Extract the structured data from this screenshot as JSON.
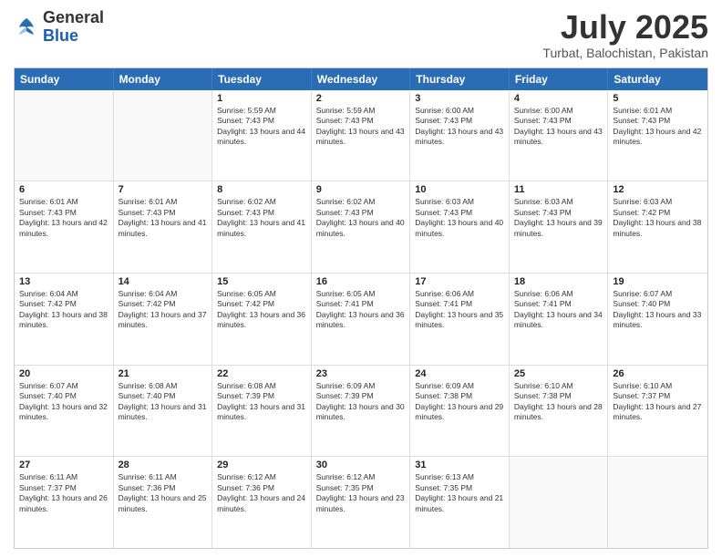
{
  "logo": {
    "general": "General",
    "blue": "Blue"
  },
  "title": "July 2025",
  "subtitle": "Turbat, Balochistan, Pakistan",
  "days_of_week": [
    "Sunday",
    "Monday",
    "Tuesday",
    "Wednesday",
    "Thursday",
    "Friday",
    "Saturday"
  ],
  "weeks": [
    [
      {
        "day": "",
        "sunrise": "",
        "sunset": "",
        "daylight": ""
      },
      {
        "day": "",
        "sunrise": "",
        "sunset": "",
        "daylight": ""
      },
      {
        "day": "1",
        "sunrise": "Sunrise: 5:59 AM",
        "sunset": "Sunset: 7:43 PM",
        "daylight": "Daylight: 13 hours and 44 minutes."
      },
      {
        "day": "2",
        "sunrise": "Sunrise: 5:59 AM",
        "sunset": "Sunset: 7:43 PM",
        "daylight": "Daylight: 13 hours and 43 minutes."
      },
      {
        "day": "3",
        "sunrise": "Sunrise: 6:00 AM",
        "sunset": "Sunset: 7:43 PM",
        "daylight": "Daylight: 13 hours and 43 minutes."
      },
      {
        "day": "4",
        "sunrise": "Sunrise: 6:00 AM",
        "sunset": "Sunset: 7:43 PM",
        "daylight": "Daylight: 13 hours and 43 minutes."
      },
      {
        "day": "5",
        "sunrise": "Sunrise: 6:01 AM",
        "sunset": "Sunset: 7:43 PM",
        "daylight": "Daylight: 13 hours and 42 minutes."
      }
    ],
    [
      {
        "day": "6",
        "sunrise": "Sunrise: 6:01 AM",
        "sunset": "Sunset: 7:43 PM",
        "daylight": "Daylight: 13 hours and 42 minutes."
      },
      {
        "day": "7",
        "sunrise": "Sunrise: 6:01 AM",
        "sunset": "Sunset: 7:43 PM",
        "daylight": "Daylight: 13 hours and 41 minutes."
      },
      {
        "day": "8",
        "sunrise": "Sunrise: 6:02 AM",
        "sunset": "Sunset: 7:43 PM",
        "daylight": "Daylight: 13 hours and 41 minutes."
      },
      {
        "day": "9",
        "sunrise": "Sunrise: 6:02 AM",
        "sunset": "Sunset: 7:43 PM",
        "daylight": "Daylight: 13 hours and 40 minutes."
      },
      {
        "day": "10",
        "sunrise": "Sunrise: 6:03 AM",
        "sunset": "Sunset: 7:43 PM",
        "daylight": "Daylight: 13 hours and 40 minutes."
      },
      {
        "day": "11",
        "sunrise": "Sunrise: 6:03 AM",
        "sunset": "Sunset: 7:43 PM",
        "daylight": "Daylight: 13 hours and 39 minutes."
      },
      {
        "day": "12",
        "sunrise": "Sunrise: 6:03 AM",
        "sunset": "Sunset: 7:42 PM",
        "daylight": "Daylight: 13 hours and 38 minutes."
      }
    ],
    [
      {
        "day": "13",
        "sunrise": "Sunrise: 6:04 AM",
        "sunset": "Sunset: 7:42 PM",
        "daylight": "Daylight: 13 hours and 38 minutes."
      },
      {
        "day": "14",
        "sunrise": "Sunrise: 6:04 AM",
        "sunset": "Sunset: 7:42 PM",
        "daylight": "Daylight: 13 hours and 37 minutes."
      },
      {
        "day": "15",
        "sunrise": "Sunrise: 6:05 AM",
        "sunset": "Sunset: 7:42 PM",
        "daylight": "Daylight: 13 hours and 36 minutes."
      },
      {
        "day": "16",
        "sunrise": "Sunrise: 6:05 AM",
        "sunset": "Sunset: 7:41 PM",
        "daylight": "Daylight: 13 hours and 36 minutes."
      },
      {
        "day": "17",
        "sunrise": "Sunrise: 6:06 AM",
        "sunset": "Sunset: 7:41 PM",
        "daylight": "Daylight: 13 hours and 35 minutes."
      },
      {
        "day": "18",
        "sunrise": "Sunrise: 6:06 AM",
        "sunset": "Sunset: 7:41 PM",
        "daylight": "Daylight: 13 hours and 34 minutes."
      },
      {
        "day": "19",
        "sunrise": "Sunrise: 6:07 AM",
        "sunset": "Sunset: 7:40 PM",
        "daylight": "Daylight: 13 hours and 33 minutes."
      }
    ],
    [
      {
        "day": "20",
        "sunrise": "Sunrise: 6:07 AM",
        "sunset": "Sunset: 7:40 PM",
        "daylight": "Daylight: 13 hours and 32 minutes."
      },
      {
        "day": "21",
        "sunrise": "Sunrise: 6:08 AM",
        "sunset": "Sunset: 7:40 PM",
        "daylight": "Daylight: 13 hours and 31 minutes."
      },
      {
        "day": "22",
        "sunrise": "Sunrise: 6:08 AM",
        "sunset": "Sunset: 7:39 PM",
        "daylight": "Daylight: 13 hours and 31 minutes."
      },
      {
        "day": "23",
        "sunrise": "Sunrise: 6:09 AM",
        "sunset": "Sunset: 7:39 PM",
        "daylight": "Daylight: 13 hours and 30 minutes."
      },
      {
        "day": "24",
        "sunrise": "Sunrise: 6:09 AM",
        "sunset": "Sunset: 7:38 PM",
        "daylight": "Daylight: 13 hours and 29 minutes."
      },
      {
        "day": "25",
        "sunrise": "Sunrise: 6:10 AM",
        "sunset": "Sunset: 7:38 PM",
        "daylight": "Daylight: 13 hours and 28 minutes."
      },
      {
        "day": "26",
        "sunrise": "Sunrise: 6:10 AM",
        "sunset": "Sunset: 7:37 PM",
        "daylight": "Daylight: 13 hours and 27 minutes."
      }
    ],
    [
      {
        "day": "27",
        "sunrise": "Sunrise: 6:11 AM",
        "sunset": "Sunset: 7:37 PM",
        "daylight": "Daylight: 13 hours and 26 minutes."
      },
      {
        "day": "28",
        "sunrise": "Sunrise: 6:11 AM",
        "sunset": "Sunset: 7:36 PM",
        "daylight": "Daylight: 13 hours and 25 minutes."
      },
      {
        "day": "29",
        "sunrise": "Sunrise: 6:12 AM",
        "sunset": "Sunset: 7:36 PM",
        "daylight": "Daylight: 13 hours and 24 minutes."
      },
      {
        "day": "30",
        "sunrise": "Sunrise: 6:12 AM",
        "sunset": "Sunset: 7:35 PM",
        "daylight": "Daylight: 13 hours and 23 minutes."
      },
      {
        "day": "31",
        "sunrise": "Sunrise: 6:13 AM",
        "sunset": "Sunset: 7:35 PM",
        "daylight": "Daylight: 13 hours and 21 minutes."
      },
      {
        "day": "",
        "sunrise": "",
        "sunset": "",
        "daylight": ""
      },
      {
        "day": "",
        "sunrise": "",
        "sunset": "",
        "daylight": ""
      }
    ]
  ]
}
